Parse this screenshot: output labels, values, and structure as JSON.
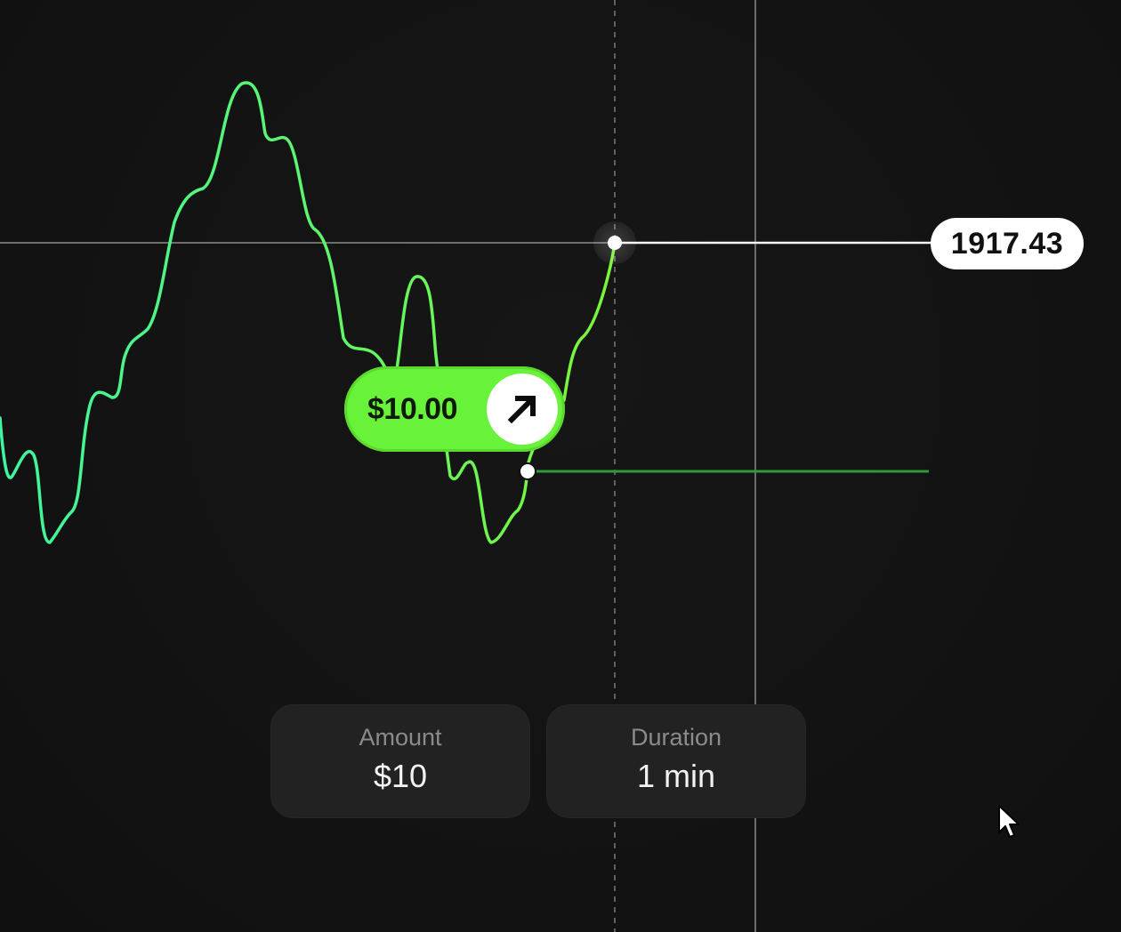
{
  "chart": {
    "current_price": "1917.43",
    "line_color_start": "#3ff5a0",
    "line_color_end": "#7cf53a",
    "entry_line_color": "#2f9a3a"
  },
  "trade": {
    "amount": "$10.00",
    "direction_icon": "arrow-up-right-icon",
    "accent": "#69f23a"
  },
  "controls": {
    "amount": {
      "label": "Amount",
      "value": "$10"
    },
    "duration": {
      "label": "Duration",
      "value": "1 min"
    }
  },
  "cursor_icon": "mouse-pointer-icon"
}
